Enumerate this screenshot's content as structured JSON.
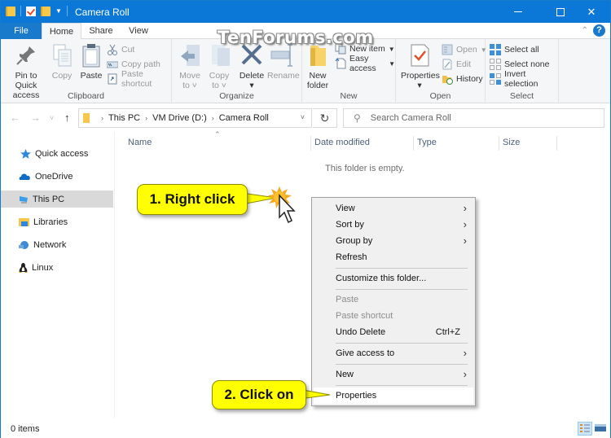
{
  "window": {
    "title": "Camera Roll",
    "controls": {
      "minimize": "minimize",
      "maximize": "maximize",
      "close": "close"
    }
  },
  "watermark": "TenForums.com",
  "ribbon": {
    "tabs": [
      {
        "label": "File"
      },
      {
        "label": "Home",
        "active": true
      },
      {
        "label": "Share"
      },
      {
        "label": "View"
      }
    ],
    "help": "?",
    "groups": {
      "clipboard": {
        "label": "Clipboard",
        "pin": "Pin to Quick access",
        "pin_line1": "Pin to Quick",
        "pin_line2": "access",
        "copy": "Copy",
        "paste": "Paste",
        "cut": "Cut",
        "copy_path": "Copy path",
        "paste_shortcut": "Paste shortcut"
      },
      "organize": {
        "label": "Organize",
        "move_to_line1": "Move",
        "move_to_line2": "to",
        "copy_to_line1": "Copy",
        "copy_to_line2": "to",
        "delete": "Delete",
        "rename": "Rename"
      },
      "new": {
        "label": "New",
        "new_folder_line1": "New",
        "new_folder_line2": "folder",
        "new_item": "New item",
        "easy_access": "Easy access"
      },
      "open": {
        "label": "Open",
        "properties": "Properties",
        "open": "Open",
        "edit": "Edit",
        "history": "History"
      },
      "select": {
        "label": "Select",
        "select_all": "Select all",
        "select_none": "Select none",
        "invert_selection": "Invert selection"
      }
    }
  },
  "address": {
    "breadcrumbs": [
      "This PC",
      "VM Drive (D:)",
      "Camera Roll"
    ],
    "search_placeholder": "Search Camera Roll"
  },
  "nav_pane": {
    "items": [
      {
        "label": "Quick access",
        "icon": "star-icon"
      },
      {
        "label": "OneDrive",
        "icon": "cloud-icon"
      },
      {
        "label": "This PC",
        "icon": "computer-icon",
        "selected": true
      },
      {
        "label": "Libraries",
        "icon": "libraries-icon"
      },
      {
        "label": "Network",
        "icon": "network-icon"
      },
      {
        "label": "Linux",
        "icon": "penguin-icon"
      }
    ]
  },
  "content": {
    "columns": [
      "Name",
      "Date modified",
      "Type",
      "Size"
    ],
    "empty_message": "This folder is empty."
  },
  "context_menu": {
    "items": [
      {
        "label": "View",
        "submenu": true
      },
      {
        "label": "Sort by",
        "submenu": true
      },
      {
        "label": "Group by",
        "submenu": true
      },
      {
        "label": "Refresh"
      },
      {
        "label": "Customize this folder..."
      },
      {
        "label": "Paste",
        "disabled": true
      },
      {
        "label": "Paste shortcut",
        "disabled": true
      },
      {
        "label": "Undo Delete",
        "shortcut": "Ctrl+Z"
      },
      {
        "label": "Give access to",
        "submenu": true
      },
      {
        "label": "New",
        "submenu": true
      },
      {
        "label": "Properties",
        "highlighted": true
      }
    ]
  },
  "callouts": {
    "step1": "1. Right click",
    "step2": "2. Click on"
  },
  "status_bar": {
    "item_count": "0 items"
  },
  "colors": {
    "titlebar": "#0b78d7",
    "file_tab": "#1979ca",
    "callout": "#ffff00",
    "selected_nav": "#d9d9d9"
  }
}
